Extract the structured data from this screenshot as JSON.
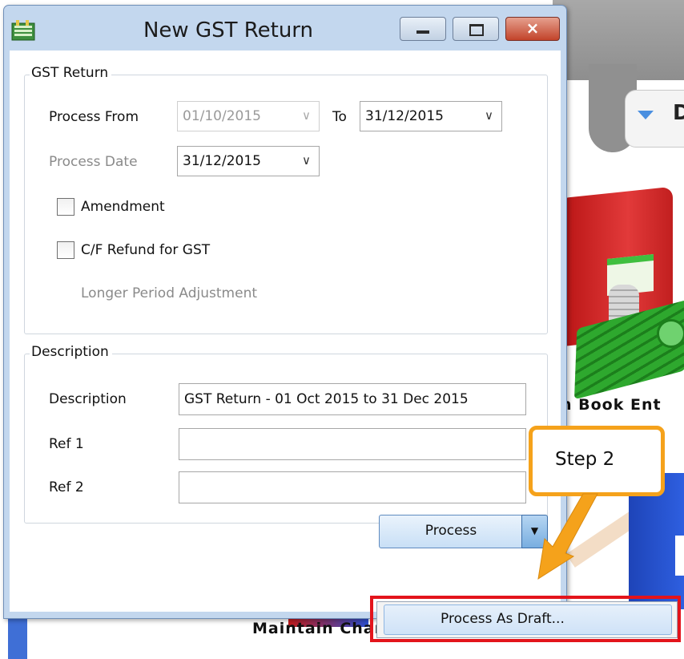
{
  "window": {
    "title": "New GST Return"
  },
  "titlebar_buttons": {
    "minimize": "minimize-icon",
    "maximize": "maximize-icon",
    "close": "×"
  },
  "gst_return_group": {
    "title": "GST Return",
    "process_from_label": "Process From",
    "process_from_value": "01/10/2015",
    "to_label": "To",
    "to_value": "31/12/2015",
    "process_date_label": "Process Date",
    "process_date_value": "31/12/2015",
    "amendment_label": "Amendment",
    "amendment_checked": false,
    "cf_refund_label": "C/F Refund for GST",
    "cf_refund_checked": false,
    "longer_period_label": "Longer Period Adjustment"
  },
  "description_group": {
    "title": "Description",
    "description_label": "Description",
    "description_value": "GST Return - 01 Oct 2015 to 31 Dec 2015",
    "ref1_label": "Ref 1",
    "ref1_value": "",
    "ref2_label": "Ref 2",
    "ref2_value": ""
  },
  "actions": {
    "process_label": "Process",
    "dropdown_arrow": "▼",
    "menu_items": [
      "Process As Draft..."
    ]
  },
  "annotation": {
    "callout_text": "Step 2",
    "callout_color": "#f5a21b",
    "highlight_color": "#e3141b"
  },
  "background_app": {
    "tab_text": "D",
    "book_entry_text": "h Book Ent",
    "maintain_text": "Maintain Chart"
  }
}
